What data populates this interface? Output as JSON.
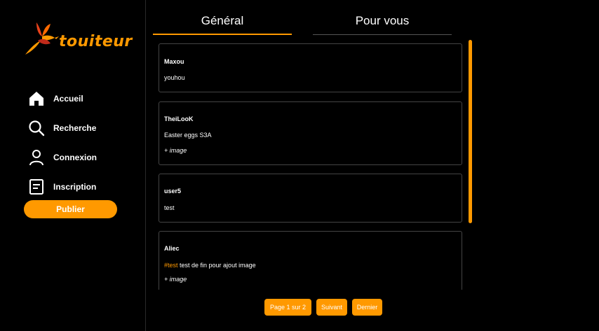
{
  "app": {
    "name": "touiteur",
    "logo_text": "touiteur",
    "accent_color": "#ff9900",
    "background_color": "#000000"
  },
  "sidebar": {
    "items": [
      {
        "label": "Accueil",
        "icon": "home-icon"
      },
      {
        "label": "Recherche",
        "icon": "search-icon"
      },
      {
        "label": "Connexion",
        "icon": "user-icon"
      },
      {
        "label": "Inscription",
        "icon": "document-icon"
      }
    ],
    "publish_label": "Publier"
  },
  "tabs": [
    {
      "label": "Général",
      "active": true
    },
    {
      "label": "Pour vous",
      "active": false
    }
  ],
  "posts": [
    {
      "author": "Maxou",
      "content": "youhou"
    },
    {
      "author": "TheiLooK",
      "content": "Easter eggs S3A",
      "image_note": "+ image"
    },
    {
      "author": "user5",
      "content": "test"
    },
    {
      "author": "Aliec",
      "hashtag": "#test",
      "content": " test de fin pour ajout image",
      "image_note": "+ image"
    }
  ],
  "pagination": {
    "page_label": "Page 1 sur 2",
    "next_label": "Suivant",
    "last_label": "Dernier"
  }
}
